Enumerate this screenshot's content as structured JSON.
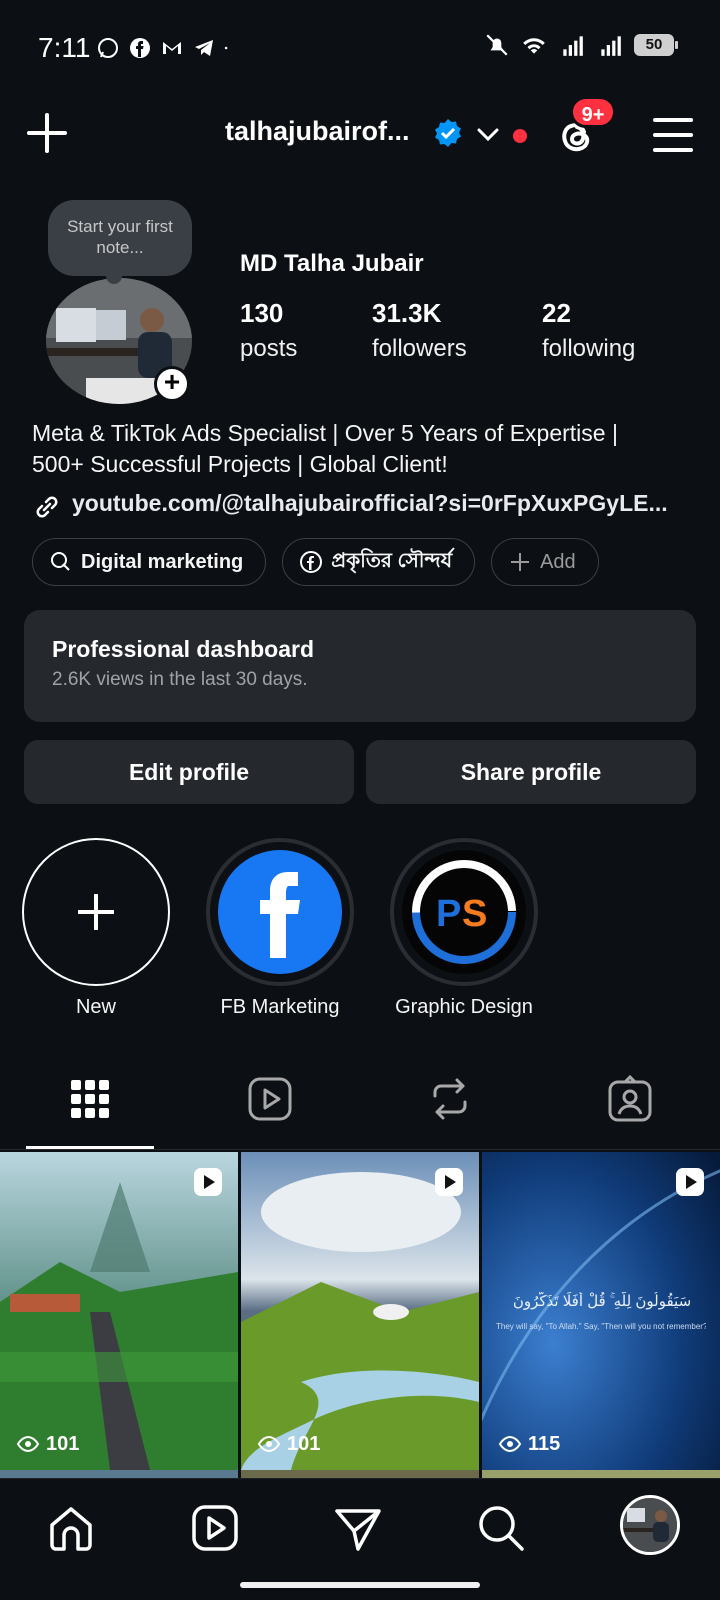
{
  "status_bar": {
    "time": "7:11",
    "battery": "50"
  },
  "header": {
    "username": "talhajubairof...",
    "notification_badge": "9+"
  },
  "profile": {
    "note_placeholder": "Start your first note...",
    "full_name": "MD Talha Jubair",
    "stats": [
      {
        "value": "130",
        "label": "posts"
      },
      {
        "value": "31.3K",
        "label": "followers"
      },
      {
        "value": "22",
        "label": "following"
      }
    ],
    "bio_line1": "Meta & TikTok Ads Specialist | Over 5 Years of Expertise |",
    "bio_line2": "500+ Successful Projects | Global Client!",
    "link": "youtube.com/@talhajubairofficial?si=0rFpXuxPGyLE...",
    "chips": [
      {
        "label": "Digital marketing",
        "icon": "chat-icon"
      },
      {
        "label": "প্রকৃতির সৌন্দর্য",
        "icon": "facebook-icon"
      },
      {
        "label": "Add",
        "icon": "plus-icon"
      }
    ]
  },
  "dashboard": {
    "title": "Professional dashboard",
    "subtitle": "2.6K views in the last 30 days."
  },
  "buttons": {
    "edit": "Edit profile",
    "share": "Share profile"
  },
  "highlights": [
    {
      "label": "New"
    },
    {
      "label": "FB Marketing"
    },
    {
      "label": "Graphic Design"
    }
  ],
  "posts": [
    {
      "views": "101"
    },
    {
      "views": "101"
    },
    {
      "views": "115",
      "overlay_arabic": "سَيَقُولُونَ لِلَّهِ ۚ قُلْ أَفَلَا تَذَكَّرُونَ",
      "overlay_english": "They will say, \"To Allah.\" Say, \"Then will you not remember?\""
    }
  ],
  "colors": {
    "accent_red": "#ff3040",
    "verified_blue": "#0095f6",
    "background": "#0c1014",
    "card": "#25292e"
  }
}
